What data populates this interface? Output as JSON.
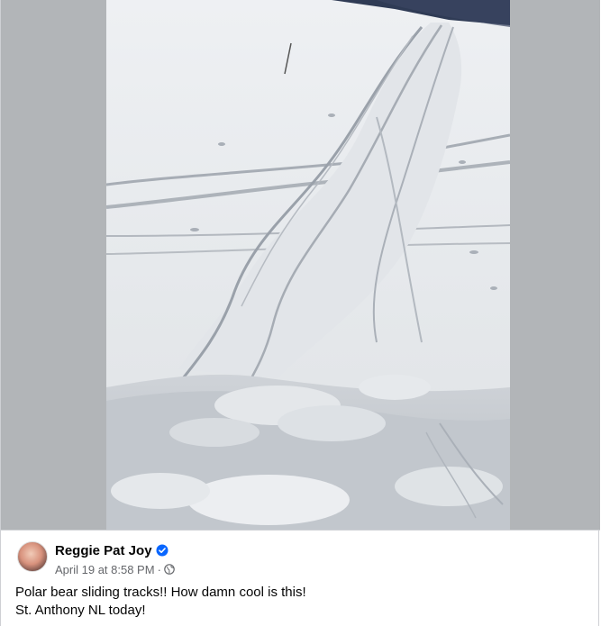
{
  "post": {
    "author_name": "Reggie Pat Joy",
    "timestamp": "April 19 at 8:58 PM",
    "separator": "·",
    "verified_icon": "verified-badge-icon",
    "privacy_icon": "globe-icon",
    "text_lines": [
      "Polar bear sliding tracks!! How damn cool is this!",
      "St. Anthony NL today!"
    ]
  },
  "colors": {
    "letterbox": "#b2b5b8",
    "verified_blue": "#0866ff",
    "meta_gray": "#65676b",
    "text": "#050505"
  }
}
